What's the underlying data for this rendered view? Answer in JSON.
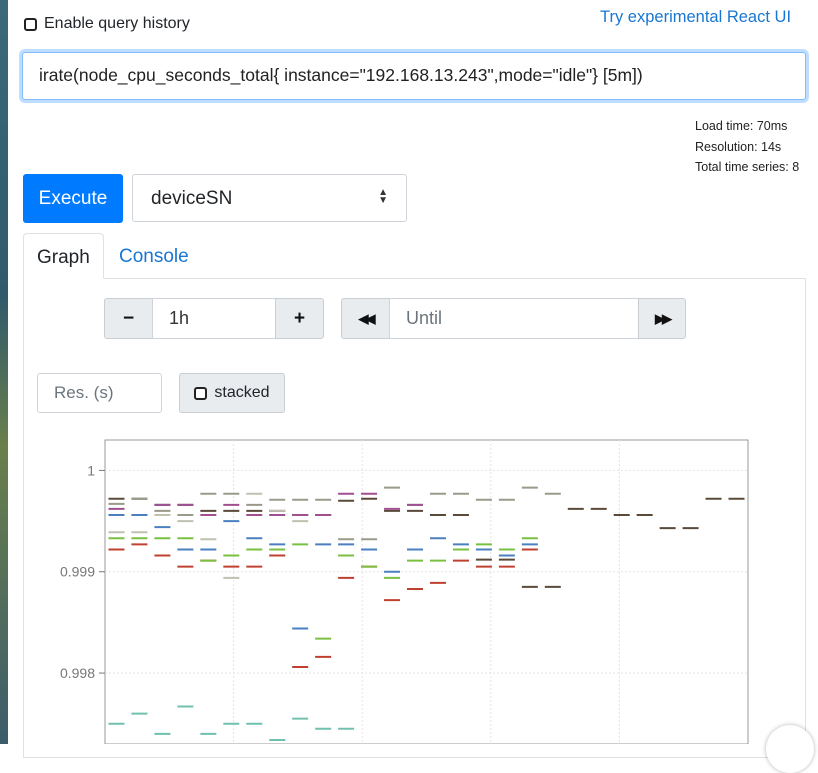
{
  "header": {
    "enable_history_label": "Enable query history",
    "react_link_label": "Try experimental React UI"
  },
  "query": {
    "expression": "irate(node_cpu_seconds_total{ instance=\"192.168.13.243\",mode=\"idle\"} [5m])"
  },
  "stats": {
    "load_time": "Load time: 70ms",
    "resolution": "Resolution: 14s",
    "total_series": "Total time series: 8"
  },
  "controls": {
    "execute_label": "Execute",
    "metric_select_value": "deviceSN"
  },
  "tabs": [
    {
      "label": "Graph",
      "active": true
    },
    {
      "label": "Console",
      "active": false
    }
  ],
  "graph_controls": {
    "minus_label": "−",
    "range_value": "1h",
    "plus_label": "+",
    "back_label": "◀◀",
    "until_placeholder": "Until",
    "forward_label": "▶▶",
    "resolution_placeholder": "Res. (s)",
    "stacked_label": "stacked"
  },
  "chart_data": {
    "type": "scatter",
    "ylim": [
      0.9973,
      1.0003
    ],
    "yticks": [
      {
        "value": 1,
        "label": "1"
      },
      {
        "value": 0.999,
        "label": "0.999"
      },
      {
        "value": 0.998,
        "label": "0.998"
      }
    ],
    "grid": true,
    "legend": "none",
    "x": [
      0,
      1,
      2,
      3,
      4,
      5,
      6,
      7,
      8,
      9,
      10,
      11,
      12,
      13,
      14,
      15,
      16,
      17,
      18,
      19,
      20,
      21,
      22,
      23,
      24,
      25,
      26,
      27
    ],
    "series": [
      {
        "color": "#5a4a3a",
        "values": [
          0.99972,
          0.99972,
          0.99966,
          0.99966,
          0.9996,
          0.9996,
          0.9996,
          0.9996,
          0.99956,
          0.99956,
          0.9997,
          0.99972,
          0.9996,
          0.9996,
          0.99956,
          0.99956,
          0.99912,
          0.99912,
          0.99885,
          0.99885,
          0.99962,
          0.99962,
          0.99956,
          0.99956,
          0.99943,
          0.99943,
          0.99972,
          0.99972
        ]
      },
      {
        "color": "#9a9a8a",
        "values": [
          0.99967,
          0.99972,
          0.9996,
          0.99956,
          0.99977,
          0.99977,
          0.99966,
          0.99971,
          0.99971,
          0.99971,
          0.99932,
          0.99932,
          0.99983,
          0.99966,
          0.99977,
          0.99977,
          0.99971,
          0.99971,
          0.99983,
          0.99977
        ]
      },
      {
        "color": "#a05090",
        "values": [
          0.99962,
          0.99956,
          0.99966,
          0.99966,
          0.99956,
          0.99966,
          0.99956,
          0.99956,
          0.99956,
          0.99956,
          0.99977,
          0.99977,
          0.99962,
          0.99966
        ]
      },
      {
        "color": "#4a80c0",
        "values": [
          0.99956,
          0.99956,
          0.99944,
          0.99922,
          0.99922,
          0.9995,
          0.99933,
          0.99927,
          0.99844,
          0.99927,
          0.99927,
          0.99922,
          0.999,
          0.99922,
          0.99933,
          0.99927,
          0.99922,
          0.99916,
          0.99927
        ]
      },
      {
        "color": "#c04030",
        "values": [
          0.99922,
          0.99927,
          0.99916,
          0.99905,
          0.99911,
          0.99905,
          0.99905,
          0.99916,
          0.99806,
          0.99816,
          0.99894,
          0.99905,
          0.99872,
          0.99883,
          0.99889,
          0.99911,
          0.99905,
          0.99905,
          0.99922
        ]
      },
      {
        "color": "#7ac040",
        "values": [
          0.99933,
          0.99933,
          0.99933,
          0.99933,
          0.99911,
          0.99916,
          0.99922,
          0.99922,
          0.99927,
          0.99834,
          0.99916,
          0.99905,
          0.99894,
          0.99911,
          0.99911,
          0.99922,
          0.99927,
          0.99922,
          0.99933
        ]
      },
      {
        "color": "#c0c0b0",
        "values": [
          0.99939,
          0.99939,
          0.99956,
          0.9995,
          0.99932,
          0.99894,
          0.99977,
          0.9996,
          0.9995
        ]
      },
      {
        "color": "#70c0b0",
        "values": [
          0.9975,
          0.9976,
          0.9974,
          0.99767,
          0.9974,
          0.9975,
          0.9975,
          0.99734,
          0.99755,
          0.99745,
          0.99745
        ]
      }
    ]
  }
}
